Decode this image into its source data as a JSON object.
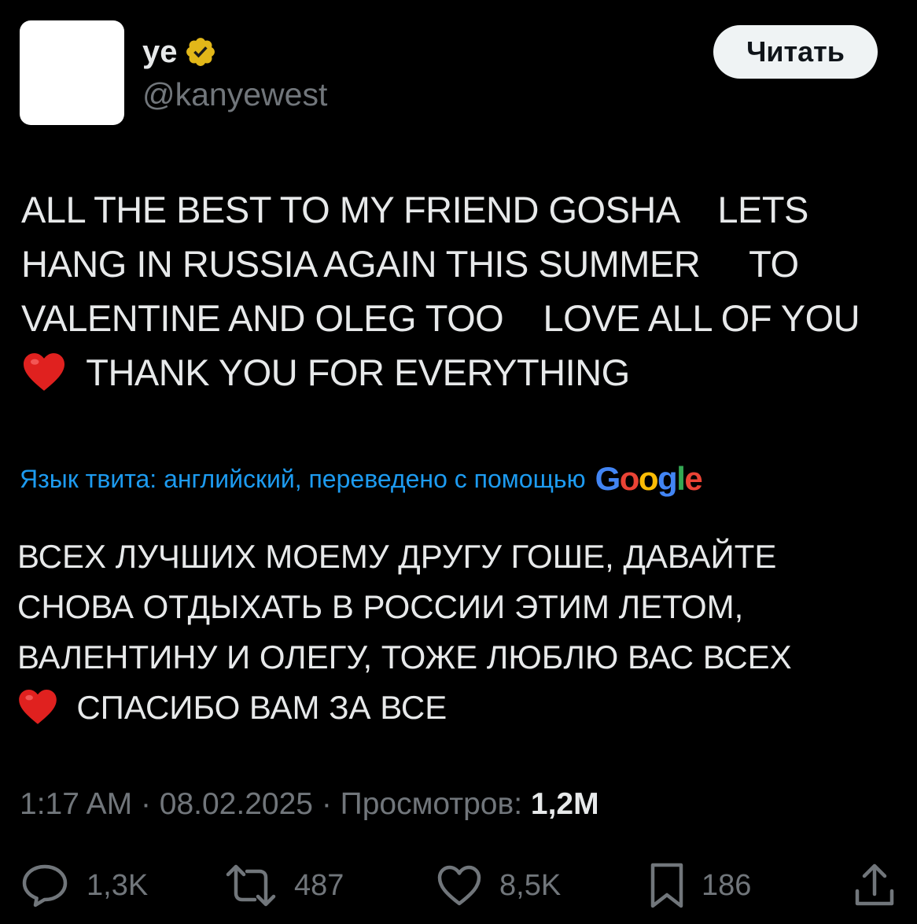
{
  "author": {
    "display_name": "ye",
    "handle": "@kanyewest",
    "verified_color": "#e2b719"
  },
  "follow_button": {
    "label": "Читать"
  },
  "tweet": {
    "lines": [
      "ALL THE BEST TO MY FRIEND GOSHA    LETS",
      "HANG IN RUSSIA AGAIN THIS SUMMER     TO",
      "VALENTINE AND OLEG TOO    LOVE ALL OF YOU",
      "THANK YOU FOR EVERYTHING"
    ],
    "heart_icon": "red-heart-emoji"
  },
  "translation": {
    "notice": "Язык твита: английский, переведено с помощью",
    "provider": "Google",
    "lines": [
      "ВСЕХ ЛУЧШИХ МОЕМУ ДРУГУ ГОШЕ, ДАВАЙТЕ",
      "СНОВА ОТДЫХАТЬ В РОССИИ ЭТИМ ЛЕТОМ,",
      "ВАЛЕНТИНУ И ОЛЕГУ, ТОЖЕ ЛЮБЛЮ ВАС ВСЕХ",
      "СПАСИБО ВАМ ЗА ВСЕ"
    ]
  },
  "meta": {
    "time": "1:17 AM",
    "date": "08.02.2025",
    "views_label": "Просмотров:",
    "views_count": "1,2M",
    "separator": "·"
  },
  "actions": {
    "replies": "1,3K",
    "reposts": "487",
    "likes": "8,5K",
    "bookmarks": "186"
  },
  "colors": {
    "background": "#000000",
    "text": "#e7e9ea",
    "muted": "#71767b",
    "link": "#1d9bf0",
    "button_bg": "#eff3f4"
  }
}
